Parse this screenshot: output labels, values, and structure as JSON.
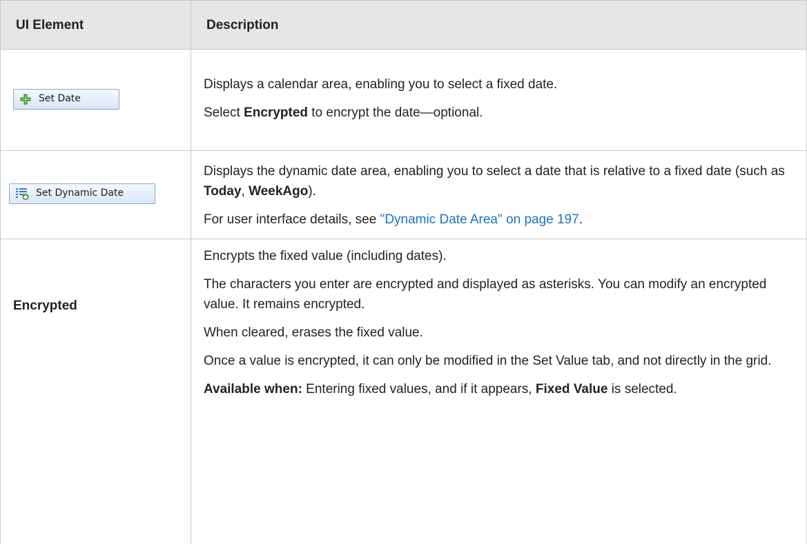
{
  "table": {
    "headers": [
      "UI Element",
      "Description"
    ],
    "rows": {
      "set_date": {
        "button_label": "Set Date",
        "desc_line1": "Displays a calendar area, enabling you to select a fixed date.",
        "desc2_pre": "Select ",
        "desc2_bold": "Encrypted",
        "desc2_post": " to encrypt the date—optional."
      },
      "set_dynamic_date": {
        "button_label": "Set Dynamic Date",
        "desc1_pre": "Displays the dynamic date area, enabling you to select a date that is relative to a fixed date (such as ",
        "desc1_bold1": "Today",
        "desc1_sep": ", ",
        "desc1_bold2": "WeekAgo",
        "desc1_post": ").",
        "desc2_pre": "For user interface details, see ",
        "desc2_link": "\"Dynamic Date Area\" on page 197",
        "desc2_post": "."
      },
      "encrypted": {
        "label": "Encrypted",
        "p1": "Encrypts the fixed value (including dates).",
        "p2": "The characters you enter are encrypted and displayed as asterisks. You can modify an encrypted value. It remains encrypted.",
        "p3": "When cleared, erases the fixed value.",
        "p4": "Once a value is encrypted, it can only be modified in the Set Value tab, and not directly in the grid.",
        "p5_bold": "Available when:",
        "p5_mid": " Entering fixed values, and if it appears, ",
        "p5_bold2": "Fixed Value",
        "p5_post": " is selected."
      }
    }
  },
  "icons": {
    "set_date": "plus-icon",
    "set_dynamic_date": "dynamic-list-icon"
  },
  "colors": {
    "header_bg": "#e6e6e6",
    "border": "#c8c8c8",
    "link": "#1a73c3"
  }
}
